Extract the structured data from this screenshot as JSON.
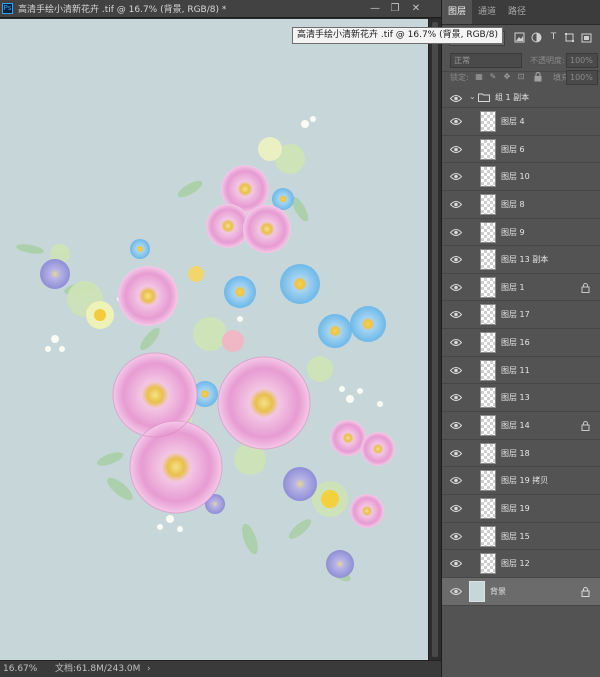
{
  "document": {
    "title": "高清手绘小清新花卉 .tif @ 16.7% (背景, RGB/8) *",
    "tooltip": "高清手绘小清新花卉 .tif @ 16.7% (背景, RGB/8)",
    "ps_icon": "Ps",
    "window_buttons": [
      "minimize-icon",
      "restore-icon",
      "close-icon"
    ],
    "canvas_color": "#c7d6d8"
  },
  "status": {
    "zoom": "16.67%",
    "doc_info": "文档:61.8M/243.0M",
    "arrow": "›"
  },
  "panel": {
    "tabs": [
      "图层",
      "通道",
      "路径"
    ],
    "filter": {
      "kind": "▾",
      "icons": [
        "image-filter-icon",
        "adjustment-filter-icon",
        "type-filter-icon",
        "shape-filter-icon",
        "smart-object-filter-icon"
      ]
    },
    "blend_mode": "正常",
    "opacity_label": "不透明度:",
    "opacity_value": "100%",
    "lock_label": "锁定:",
    "fill_label": "填充:",
    "fill_value": "100%"
  },
  "group": {
    "name": "组 1 副本",
    "expanded": true
  },
  "layers": [
    {
      "name": "图层 4",
      "locked": false
    },
    {
      "name": "图层 6",
      "locked": false
    },
    {
      "name": "图层 10",
      "locked": false
    },
    {
      "name": "图层 8",
      "locked": false
    },
    {
      "name": "图层 9",
      "locked": false
    },
    {
      "name": "图层 13 副本",
      "locked": false
    },
    {
      "name": "图层 1",
      "locked": true
    },
    {
      "name": "图层 17",
      "locked": false
    },
    {
      "name": "图层 16",
      "locked": false
    },
    {
      "name": "图层 11",
      "locked": false
    },
    {
      "name": "图层 13",
      "locked": false
    },
    {
      "name": "图层 14",
      "locked": true
    },
    {
      "name": "图层 18",
      "locked": false
    },
    {
      "name": "图层 19 拷贝",
      "locked": false
    },
    {
      "name": "图层 19",
      "locked": false
    },
    {
      "name": "图层 15",
      "locked": false
    },
    {
      "name": "图层 12",
      "locked": false
    }
  ],
  "background_layer": {
    "name": "背景",
    "locked": true
  }
}
